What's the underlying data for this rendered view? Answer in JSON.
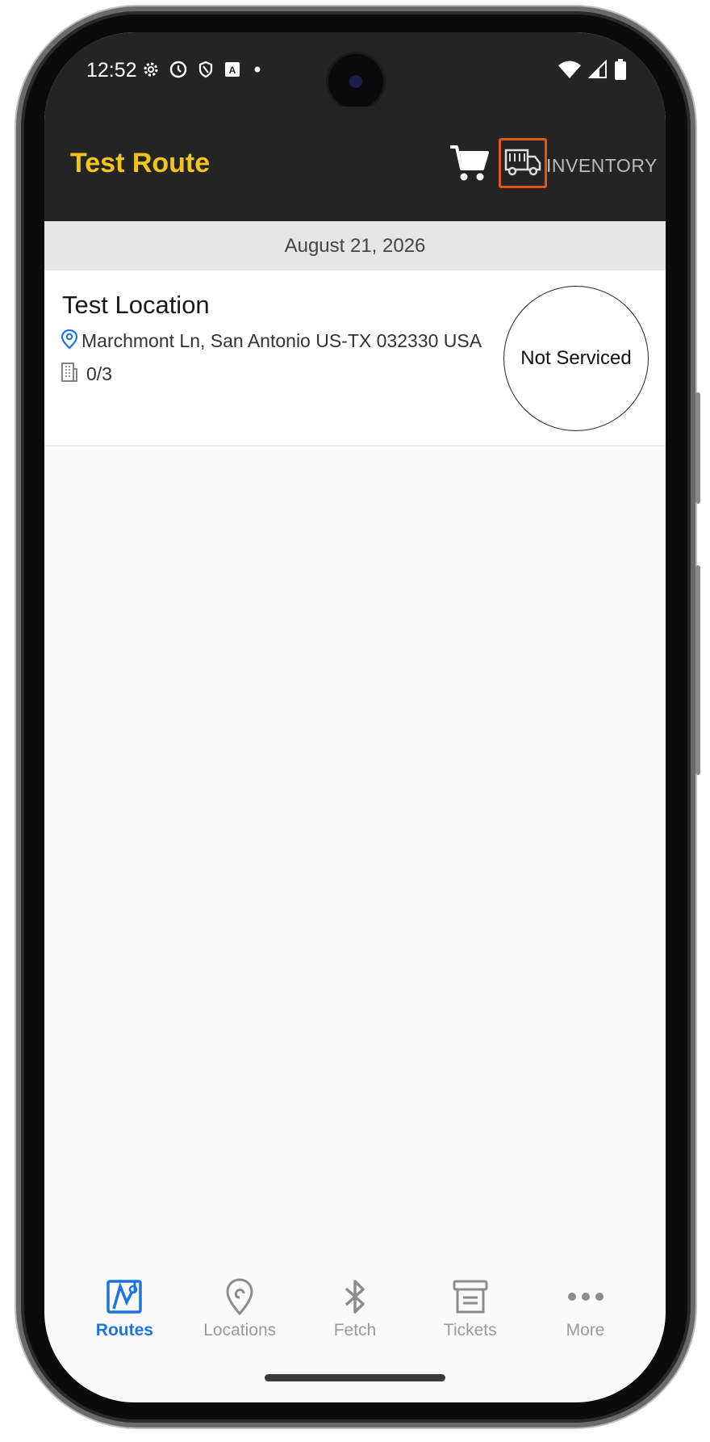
{
  "status_bar": {
    "time": "12:52",
    "left_icons": [
      "settings-icon",
      "clock-icon",
      "shield-icon",
      "a-badge-icon",
      "dot-icon"
    ],
    "right_icons": [
      "wifi-icon",
      "signal-icon",
      "battery-icon"
    ]
  },
  "app_bar": {
    "title": "Test Route",
    "cart_icon": "cart-icon",
    "truck_icon": "truck-icon",
    "inventory_label": "INVENTORY",
    "title_color": "#f4c518",
    "highlight_color": "#e2561e"
  },
  "date_header": "August 21, 2026",
  "location": {
    "name": "Test Location",
    "address": "Marchmont Ln, San Antonio US-TX 032330 USA",
    "count": "0/3",
    "status": "Not Serviced"
  },
  "bottom_nav": {
    "active_color": "#1d74e0",
    "items": [
      {
        "label": "Routes",
        "icon": "map-icon",
        "active": true
      },
      {
        "label": "Locations",
        "icon": "location-pin-icon",
        "active": false
      },
      {
        "label": "Fetch",
        "icon": "bluetooth-icon",
        "active": false
      },
      {
        "label": "Tickets",
        "icon": "ticket-icon",
        "active": false
      },
      {
        "label": "More",
        "icon": "more-dots-icon",
        "active": false
      }
    ]
  }
}
